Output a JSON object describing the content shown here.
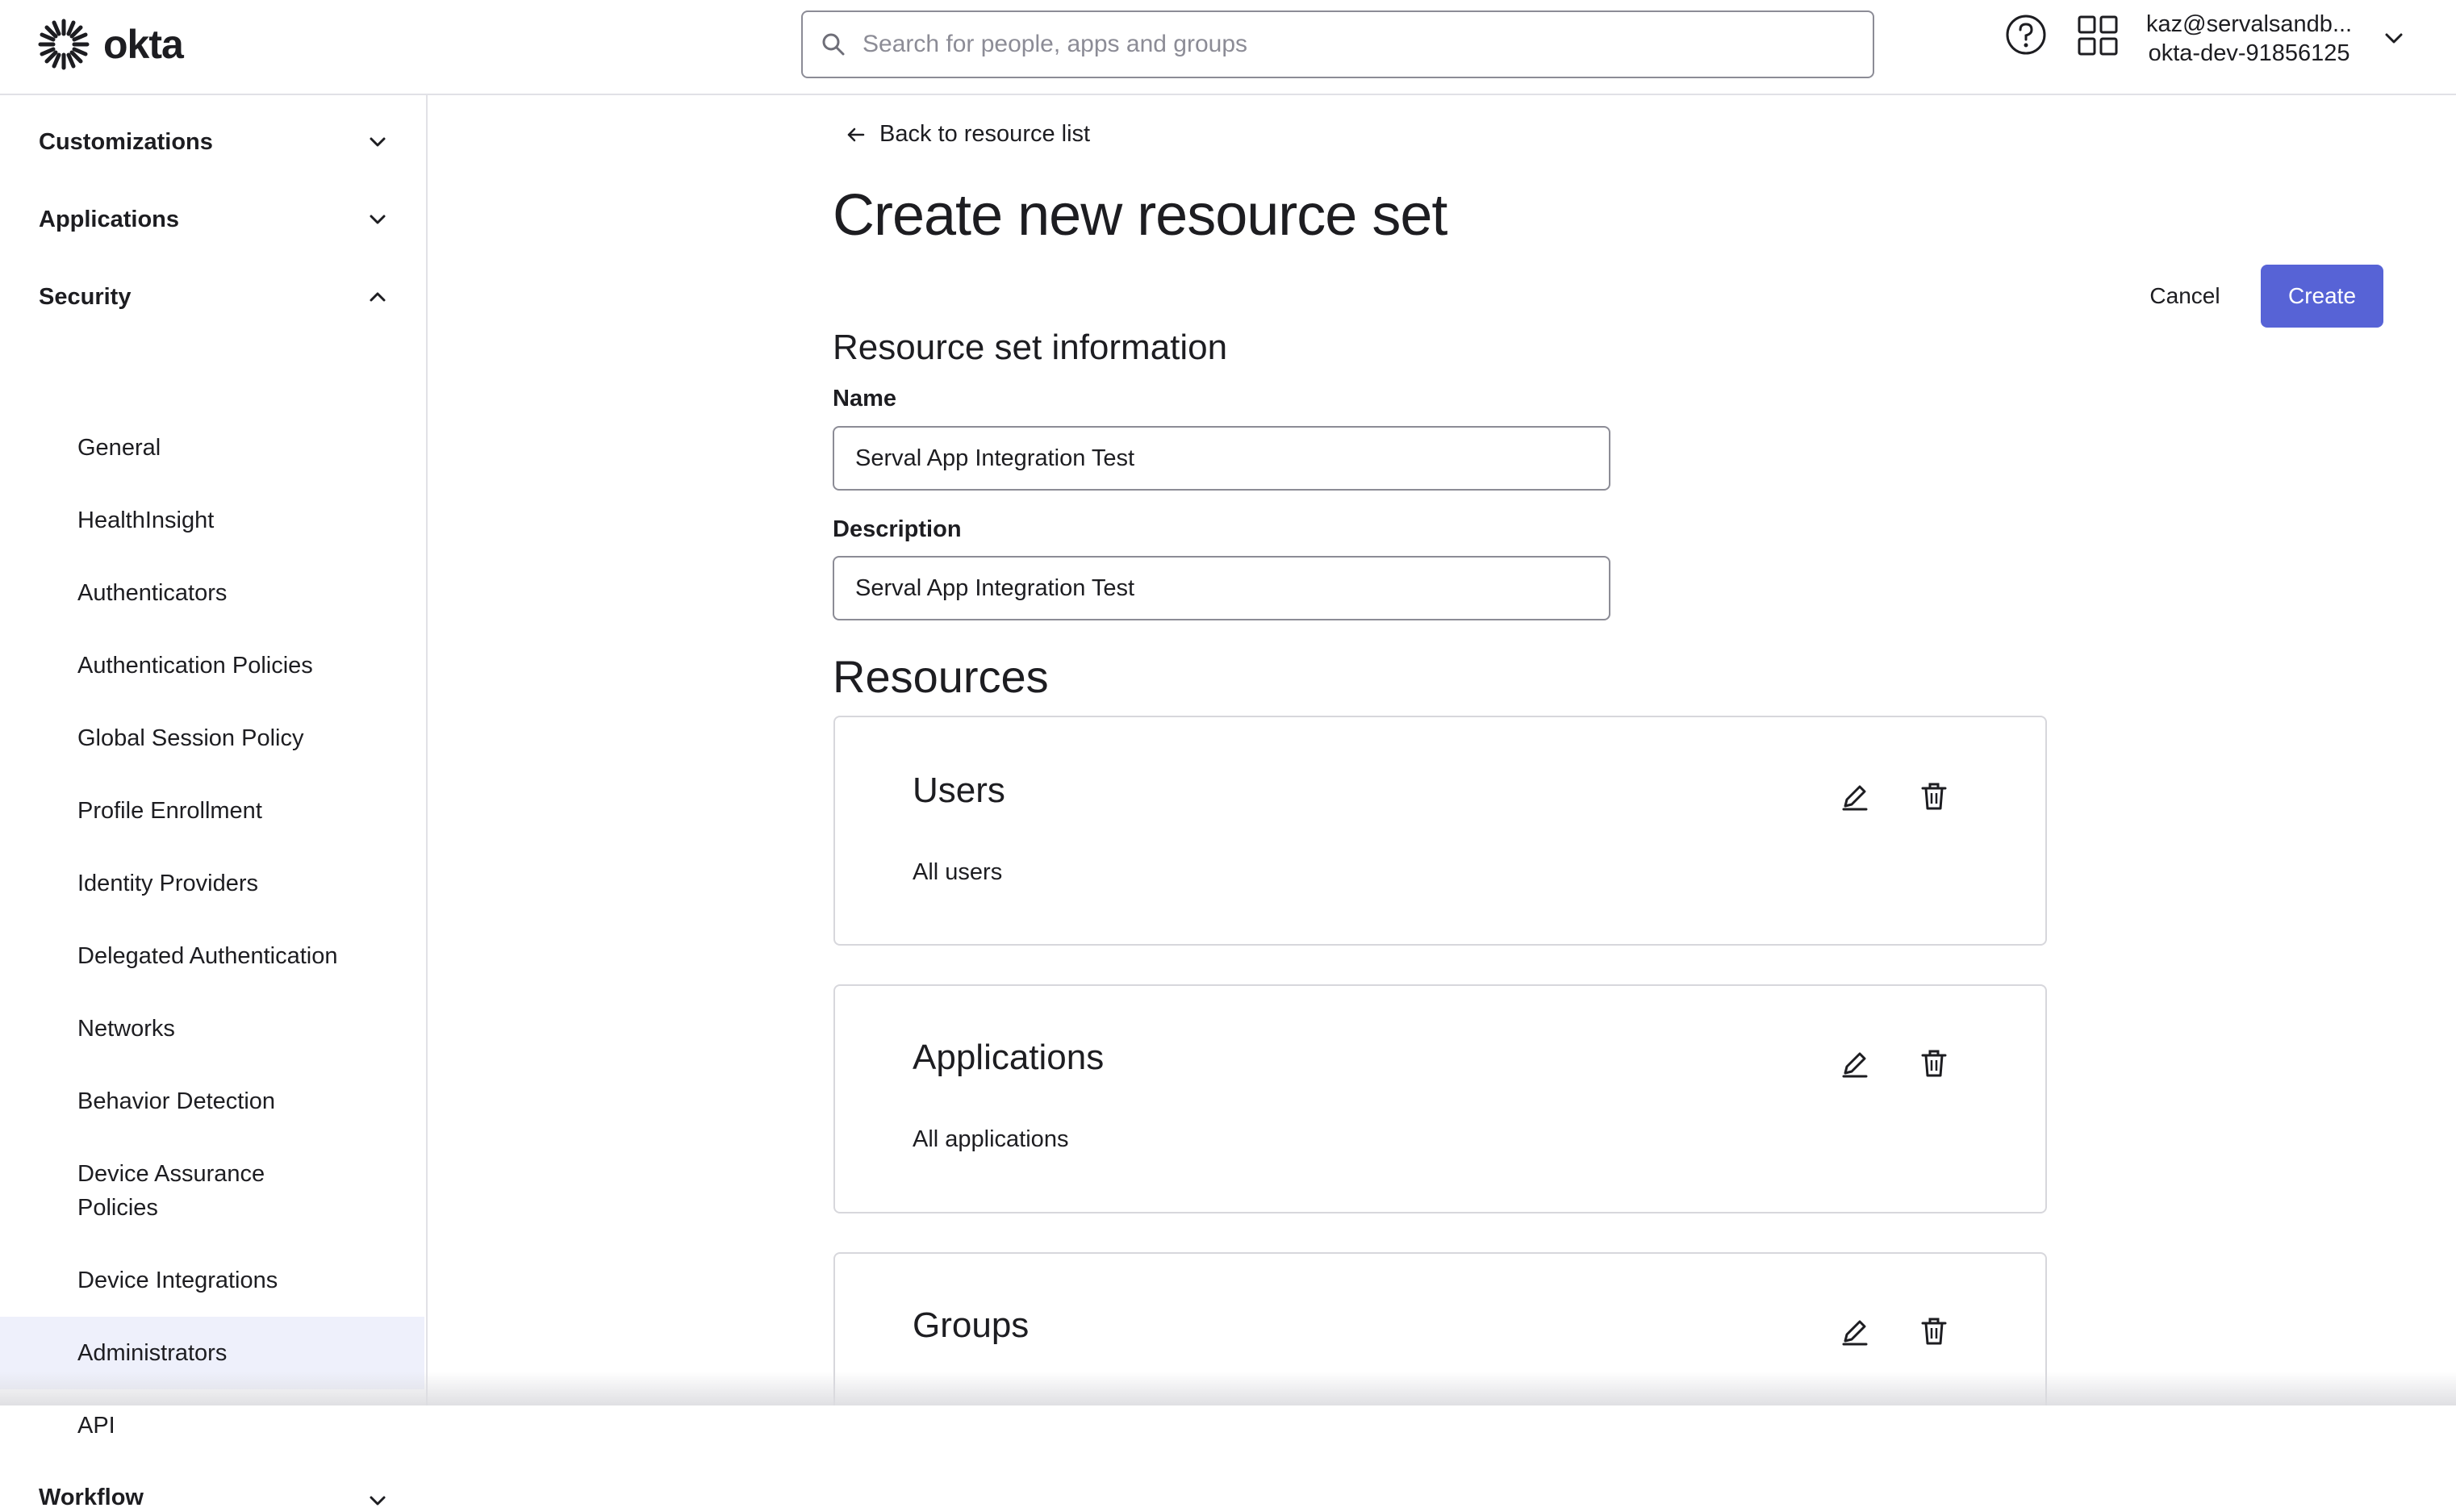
{
  "header": {
    "logo_text": "okta",
    "search_placeholder": "Search for people, apps and groups",
    "user_email": "kaz@servalsandb...",
    "org_name": "okta-dev-91856125"
  },
  "sidebar": {
    "sections": [
      {
        "label": "Customizations",
        "expanded": false
      },
      {
        "label": "Applications",
        "expanded": false
      },
      {
        "label": "Security",
        "expanded": true
      },
      {
        "label": "Workflow",
        "expanded": false
      }
    ],
    "security_items": [
      {
        "label": "General"
      },
      {
        "label": "HealthInsight"
      },
      {
        "label": "Authenticators"
      },
      {
        "label": "Authentication Policies"
      },
      {
        "label": "Global Session Policy"
      },
      {
        "label": "Profile Enrollment"
      },
      {
        "label": "Identity Providers"
      },
      {
        "label": "Delegated Authentication"
      },
      {
        "label": "Networks"
      },
      {
        "label": "Behavior Detection"
      },
      {
        "label": "Device Assurance",
        "label2": "Policies"
      },
      {
        "label": "Device Integrations"
      },
      {
        "label": "Administrators",
        "active": true
      },
      {
        "label": "API"
      }
    ]
  },
  "main": {
    "back_link": "Back to resource list",
    "title": "Create new resource set",
    "cancel_label": "Cancel",
    "create_label": "Create",
    "info_heading": "Resource set information",
    "name_label": "Name",
    "name_value": "Serval App Integration Test",
    "description_label": "Description",
    "description_value": "Serval App Integration Test",
    "resources_heading": "Resources",
    "resources": [
      {
        "title": "Users",
        "description": "All users"
      },
      {
        "title": "Applications",
        "description": "All applications"
      },
      {
        "title": "Groups",
        "description": ""
      }
    ]
  },
  "colors": {
    "primary_button": "#5763d6",
    "active_nav_bg": "#eef0fb",
    "border": "#e1e1e6"
  }
}
